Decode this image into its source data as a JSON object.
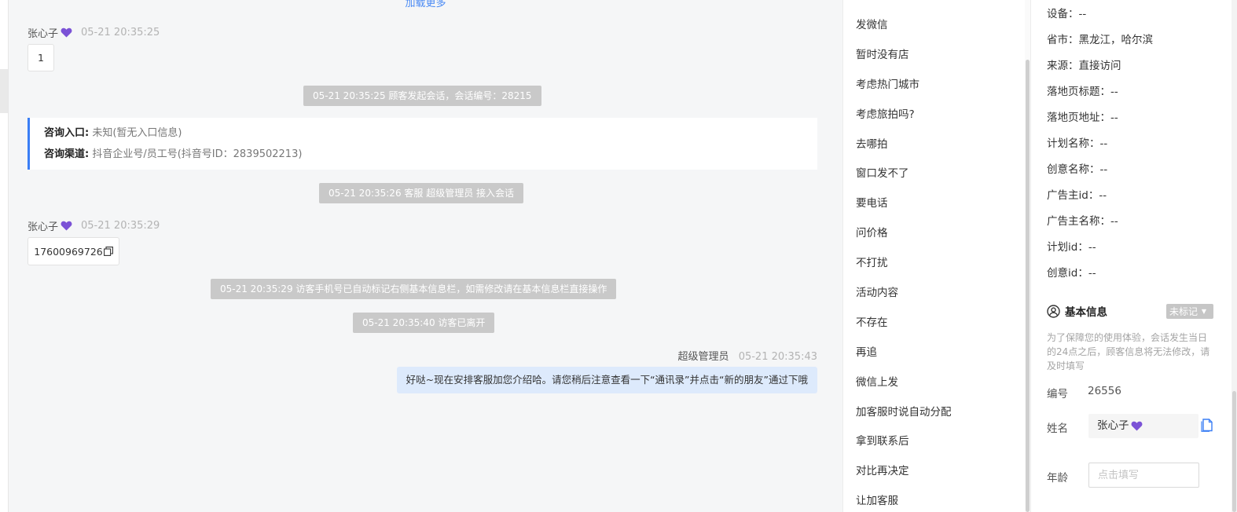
{
  "chat": {
    "load_more": "加载更多",
    "messages": [
      {
        "sender": "张心子",
        "time": "05-21 20:35:25",
        "text": "1"
      },
      {
        "system": "05-21 20:35:25 顾客发起会话，会话编号：28215"
      },
      {
        "system": "05-21 20:35:26 客服 超级管理员 接入会话"
      },
      {
        "sender": "张心子",
        "time": "05-21 20:35:29",
        "text": "17600969726"
      },
      {
        "system": "05-21 20:35:29 访客手机号已自动标记右侧基本信息栏，如需修改请在基本信息栏直接操作"
      },
      {
        "system": "05-21 20:35:40 访客已离开"
      },
      {
        "sender": "超级管理员",
        "time": "05-21 20:35:43",
        "text": "好哒~现在安排客服加您介绍哈。请您稍后注意查看一下“通讯录”并点击“新的朋友”通过下哦"
      }
    ],
    "entry": {
      "entrance_label": "咨询入口:",
      "entrance_value": "未知(暂无入口信息)",
      "channel_label": "咨询渠道:",
      "channel_value": "抖音企业号/员工号(抖音号ID：2839502213)"
    }
  },
  "quick_replies": [
    "发微信",
    "暂时没有店",
    "考虑热门城市",
    "考虑旅拍吗?",
    "去哪拍",
    "窗口发不了",
    "要电话",
    "问价格",
    "不打扰",
    "活动内容",
    "不存在",
    "再追",
    "微信上发",
    "加客服时说自动分配",
    "拿到联系后",
    "对比再决定",
    "让加客服"
  ],
  "info": {
    "lines": [
      "设备：--",
      "省市：黑龙江，哈尔滨",
      "来源：直接访问",
      "落地页标题：--",
      "落地页地址：--",
      "计划名称：--",
      "创意名称：--",
      "广告主id：--",
      "广告主名称：--",
      "计划id：--",
      "创意id：--"
    ],
    "basic_title": "基本信息",
    "mark_tag": "未标记",
    "tip": "为了保障您的使用体验，会话发生当日的24点之后，顾客信息将无法修改，请及时填写",
    "id_label": "编号",
    "id_value": "26556",
    "name_label": "姓名",
    "name_value": "张心子",
    "age_label": "年龄",
    "age_placeholder": "点击填写"
  },
  "colors": {
    "accent": "#3a7ef5",
    "heart": "#7b52d6",
    "agent_bubble": "#ddeafc",
    "system_bg": "#c9c9c9"
  }
}
